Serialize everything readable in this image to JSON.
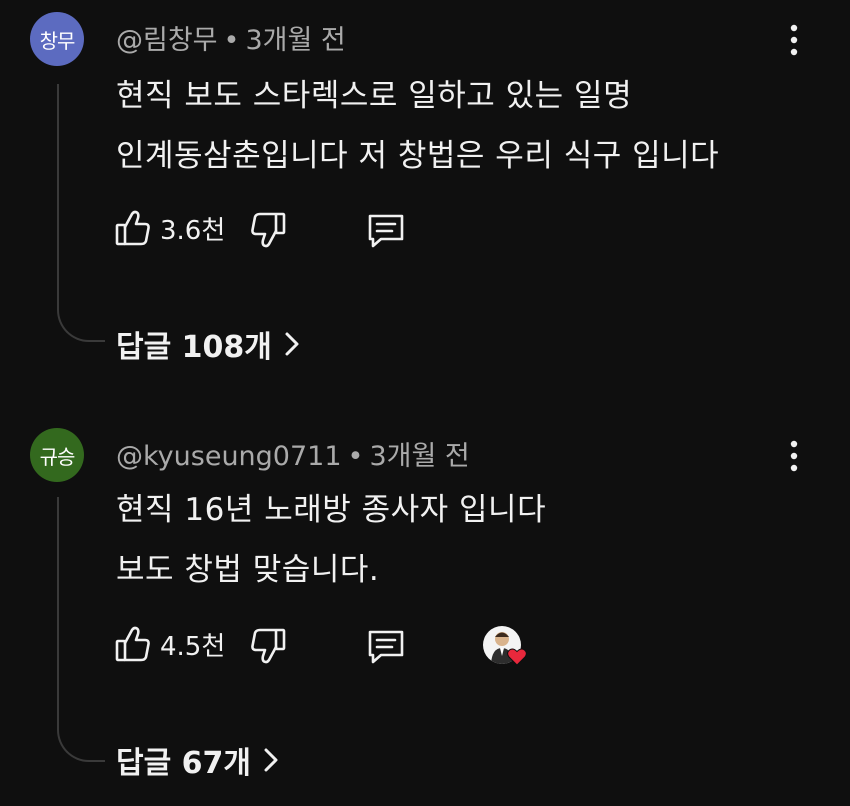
{
  "comments": [
    {
      "avatar_text": "창무",
      "avatar_color": "#5c6bc0",
      "handle": "@림창무",
      "time": "3개월 전",
      "lines": [
        "현직 보도 스타렉스로 일하고 있는 일명",
        "인계동삼춘입니다 저 창법은 우리 식구 입니다"
      ],
      "likes": "3.6천",
      "replies": "답글 108개",
      "creator_heart": false
    },
    {
      "avatar_text": "규승",
      "avatar_color": "#33691e",
      "handle": "@kyuseung0711",
      "time": "3개월 전",
      "lines": [
        "현직 16년 노래방 종사자 입니다",
        "보도 창법 맞습니다."
      ],
      "likes": "4.5천",
      "replies": "답글 67개",
      "creator_heart": true
    }
  ],
  "separator": "•",
  "icons": {
    "like": "thumbs-up-icon",
    "dislike": "thumbs-down-icon",
    "reply": "comment-icon",
    "menu": "more-vertical-icon",
    "expand": "chevron-right-icon",
    "heart": "heart-icon"
  },
  "colors": {
    "background": "#0f0f0f",
    "text": "#f1f1f1",
    "secondary_text": "#aaaaaa",
    "heart": "#e8283c"
  }
}
